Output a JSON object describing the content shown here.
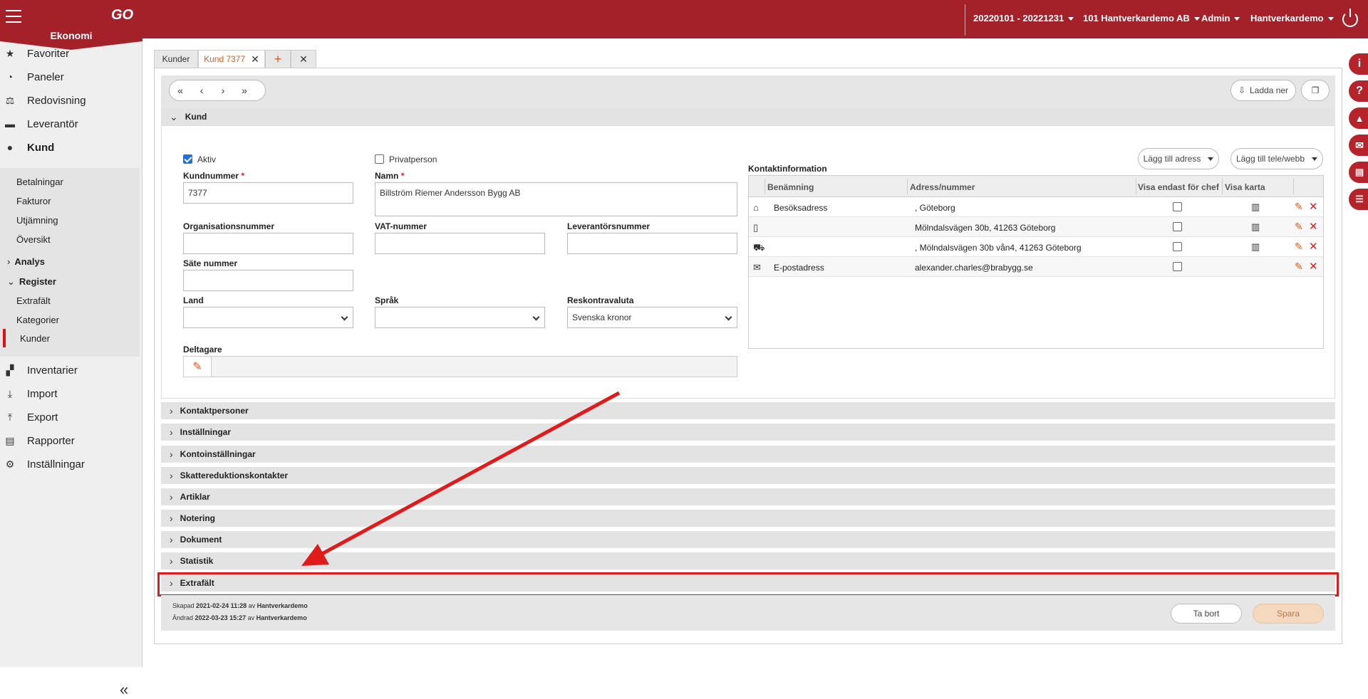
{
  "app": {
    "name": "Ekonomi",
    "logo_text": "GO"
  },
  "topbar": {
    "period": "20220101 - 20221231",
    "company": "101 Hantverkardemo AB",
    "role": "Admin",
    "user": "Hantverkardemo"
  },
  "sidebar": {
    "items": [
      {
        "label": "Favoriter",
        "icon": "star-icon"
      },
      {
        "label": "Paneler",
        "icon": "gauge-icon"
      },
      {
        "label": "Redovisning",
        "icon": "scale-icon"
      },
      {
        "label": "Leverantör",
        "icon": "truck-icon"
      },
      {
        "label": "Kund",
        "icon": "person-icon"
      }
    ],
    "kund_sub": [
      "Betalningar",
      "Fakturor",
      "Utjämning",
      "Översikt"
    ],
    "groups": {
      "analys": "Analys",
      "register": "Register"
    },
    "register_sub": [
      "Extrafält",
      "Kategorier",
      "Kunder"
    ],
    "items_after": [
      {
        "label": "Inventarier",
        "icon": "inventory-icon"
      },
      {
        "label": "Import",
        "icon": "import-icon"
      },
      {
        "label": "Export",
        "icon": "export-icon"
      },
      {
        "label": "Rapporter",
        "icon": "printer-icon"
      },
      {
        "label": "Inställningar",
        "icon": "gear-icon"
      }
    ]
  },
  "tabs": [
    {
      "label": "Kunder"
    },
    {
      "label": "Kund 7377"
    }
  ],
  "toolbar": {
    "download": "Ladda ner"
  },
  "sections": {
    "kund": "Kund"
  },
  "form": {
    "aktiv": "Aktiv",
    "privatperson": "Privatperson",
    "kundnummer_label": "Kundnummer",
    "kundnummer": "7377",
    "namn_label": "Namn",
    "namn": "Billström Riemer Andersson Bygg AB",
    "org_label": "Organisationsnummer",
    "vat_label": "VAT-nummer",
    "lev_label": "Leverantörsnummer",
    "sate_label": "Säte nummer",
    "land_label": "Land",
    "sprak_label": "Språk",
    "valuta_label": "Reskontravaluta",
    "valuta": "Svenska kronor",
    "deltagare_label": "Deltagare",
    "required": "*"
  },
  "contact": {
    "title": "Kontaktinformation",
    "add_address": "Lägg till adress",
    "add_phone": "Lägg till tele/webb",
    "columns": [
      "Benämning",
      "Adress/nummer",
      "Visa endast för chef",
      "Visa karta"
    ],
    "rows": [
      {
        "icon": "home-icon",
        "name": "Besöksadress",
        "address": ", Göteborg"
      },
      {
        "icon": "document-icon",
        "name": "",
        "address": "Mölndalsvägen 30b, 41263 Göteborg"
      },
      {
        "icon": "truck-icon",
        "name": "",
        "address": ", Mölndalsvägen 30b vån4, 41263 Göteborg"
      },
      {
        "icon": "envelope-icon",
        "name": "E-postadress",
        "address": "alexander.charles@brabygg.se"
      }
    ]
  },
  "collapsed_sections": [
    "Kontaktpersoner",
    "Inställningar",
    "Kontoinställningar",
    "Skattereduktionskontakter",
    "Artiklar",
    "Notering",
    "Dokument",
    "Statistik",
    "Extrafält"
  ],
  "footer": {
    "created_label": "Skapad",
    "created_date": "2021-02-24 11:28",
    "by": "av",
    "created_by": "Hantverkardemo",
    "changed_label": "Ändrad",
    "changed_date": "2022-03-23 15:27",
    "changed_by": "Hantverkardemo",
    "delete": "Ta bort",
    "save": "Spara"
  },
  "colors": {
    "brand": "#a5212a",
    "highlight": "#e01b1b",
    "accent": "#e05a20"
  }
}
